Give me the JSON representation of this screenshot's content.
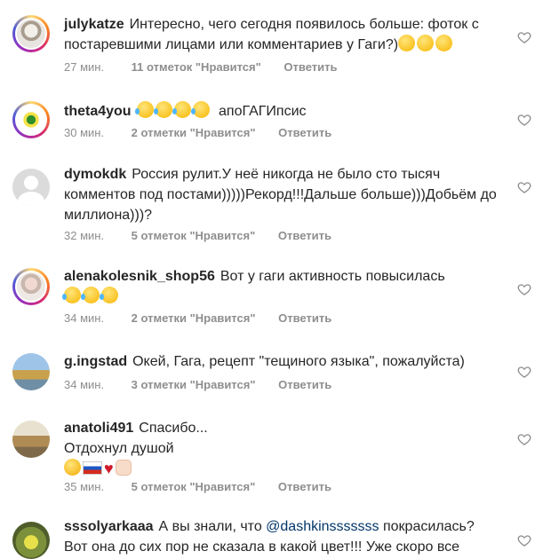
{
  "comments": [
    {
      "username": "julykatze",
      "text": "Интересно, чего сегодня появилось больше: фоток с постаревшими лицами или комментариев у Гаги?)",
      "emojis": [
        "grinning-sweat-emoji",
        "grinning-sweat-emoji",
        "grinning-sweat-emoji"
      ],
      "time": "27 мин.",
      "likes": "11 отметок \"Нравится\"",
      "reply": "Ответить",
      "avatar_story_ring": true
    },
    {
      "username": "theta4you",
      "text_after_emoji": "апоГАГИпсис",
      "emojis": [
        "tears-of-joy-emoji",
        "tears-of-joy-emoji",
        "tears-of-joy-emoji",
        "tears-of-joy-emoji"
      ],
      "time": "30 мин.",
      "likes": "2 отметки \"Нравится\"",
      "reply": "Ответить",
      "avatar_story_ring": true
    },
    {
      "username": "dymokdk",
      "text": "Россия рулит.У неё никогда не было сто тысяч комментов под постами)))))Рекорд!!!Дальше больше)))Добьём до миллиона)))?",
      "time": "32 мин.",
      "likes": "5 отметок \"Нравится\"",
      "reply": "Ответить",
      "avatar_story_ring": false
    },
    {
      "username": "alenakolesnik_shop56",
      "text": "Вот у гаги активность повысилась",
      "emojis": [
        "rofl-emoji",
        "rofl-emoji",
        "rofl-emoji"
      ],
      "time": "34 мин.",
      "likes": "2 отметки \"Нравится\"",
      "reply": "Ответить",
      "avatar_story_ring": true
    },
    {
      "username": "g.ingstad",
      "text": "Окей, Гага, рецепт \"тещиного языка\", пожалуйста)",
      "time": "34 мин.",
      "likes": "3 отметки \"Нравится\"",
      "reply": "Ответить",
      "avatar_story_ring": false
    },
    {
      "username": "anatoli491",
      "text": "Спасибо...",
      "text_line2": "Отдохнул душой",
      "emojis": [
        "hugging-emoji",
        "russia-flag-emoji",
        "red-heart-emoji",
        "raised-fist-emoji"
      ],
      "time": "35 мин.",
      "likes": "5 отметок \"Нравится\"",
      "reply": "Ответить",
      "avatar_story_ring": false
    },
    {
      "username": "sssolyarkaaa",
      "text_before": "А вы знали, что ",
      "mention": "@dashkinsssssss",
      "text_after": " покрасилась? Вот она до сих пор не сказала в какой цвет!!! Уже скоро все",
      "avatar_story_ring": false
    }
  ],
  "colors": {
    "text": "#262626",
    "meta": "#8e8e8e",
    "mention": "#003569",
    "heart_outline": "#8e8e8e"
  }
}
